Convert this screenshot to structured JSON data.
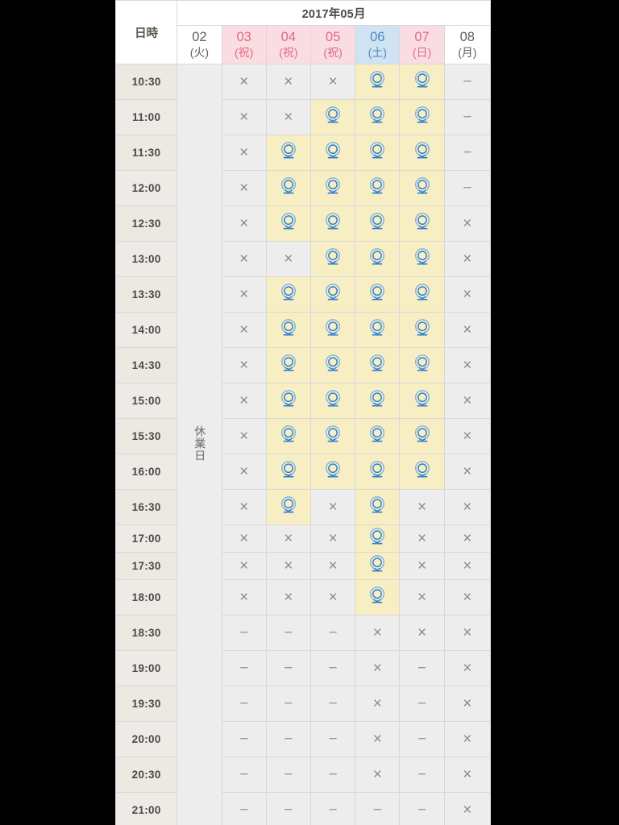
{
  "header": {
    "corner_label": "日時",
    "month_label": "2017年05月",
    "days": [
      {
        "num": "02",
        "weekday": "(火)",
        "kind": "plain"
      },
      {
        "num": "03",
        "weekday": "(祝)",
        "kind": "holiday"
      },
      {
        "num": "04",
        "weekday": "(祝)",
        "kind": "holiday"
      },
      {
        "num": "05",
        "weekday": "(祝)",
        "kind": "holiday"
      },
      {
        "num": "06",
        "weekday": "(土)",
        "kind": "sat"
      },
      {
        "num": "07",
        "weekday": "(日)",
        "kind": "holiday"
      },
      {
        "num": "08",
        "weekday": "(月)",
        "kind": "plain"
      }
    ]
  },
  "closed_column": {
    "label": "休業日",
    "chars": [
      "休",
      "業",
      "日"
    ]
  },
  "legend": {
    "available_symbol": "◎",
    "unavailable_symbol": "×",
    "na_symbol": "−"
  },
  "colors": {
    "holiday_header_bg": "#fadde3",
    "holiday_header_fg": "#e06a80",
    "saturday_header_bg": "#cfe3f2",
    "saturday_header_fg": "#4d86c6",
    "available_cell_bg": "#f7eec4",
    "available_mark_fg": "#4d94d6",
    "cell_bg": "#ededed",
    "time_cell_bg": "#ece8e2",
    "border": "#d8d8d8",
    "page_bg": "#ffffff",
    "frame_bg": "#000000"
  },
  "table": {
    "time_column_header": "日時",
    "day_columns": [
      "02",
      "03",
      "04",
      "05",
      "06",
      "07",
      "08"
    ],
    "rows": [
      {
        "time": "10:30",
        "short": false,
        "cells": [
          "closed",
          "x",
          "x",
          "x",
          "o",
          "o",
          "-"
        ]
      },
      {
        "time": "11:00",
        "short": false,
        "cells": [
          "closed",
          "x",
          "x",
          "o",
          "o",
          "o",
          "-"
        ]
      },
      {
        "time": "11:30",
        "short": false,
        "cells": [
          "closed",
          "x",
          "o",
          "o",
          "o",
          "o",
          "-"
        ]
      },
      {
        "time": "12:00",
        "short": false,
        "cells": [
          "closed",
          "x",
          "o",
          "o",
          "o",
          "o",
          "-"
        ]
      },
      {
        "time": "12:30",
        "short": false,
        "cells": [
          "closed",
          "x",
          "o",
          "o",
          "o",
          "o",
          "x"
        ]
      },
      {
        "time": "13:00",
        "short": false,
        "cells": [
          "closed",
          "x",
          "x",
          "o",
          "o",
          "o",
          "x"
        ]
      },
      {
        "time": "13:30",
        "short": false,
        "cells": [
          "closed",
          "x",
          "o",
          "o",
          "o",
          "o",
          "x"
        ]
      },
      {
        "time": "14:00",
        "short": false,
        "cells": [
          "closed",
          "x",
          "o",
          "o",
          "o",
          "o",
          "x"
        ]
      },
      {
        "time": "14:30",
        "short": false,
        "cells": [
          "closed",
          "x",
          "o",
          "o",
          "o",
          "o",
          "x"
        ]
      },
      {
        "time": "15:00",
        "short": false,
        "cells": [
          "closed",
          "x",
          "o",
          "o",
          "o",
          "o",
          "x"
        ]
      },
      {
        "time": "15:30",
        "short": false,
        "cells": [
          "closed",
          "x",
          "o",
          "o",
          "o",
          "o",
          "x"
        ]
      },
      {
        "time": "16:00",
        "short": false,
        "cells": [
          "closed",
          "x",
          "o",
          "o",
          "o",
          "o",
          "x"
        ]
      },
      {
        "time": "16:30",
        "short": false,
        "cells": [
          "closed",
          "x",
          "o",
          "x",
          "o",
          "x",
          "x"
        ]
      },
      {
        "time": "17:00",
        "short": true,
        "cells": [
          "closed",
          "x",
          "x",
          "x",
          "o",
          "x",
          "x"
        ]
      },
      {
        "time": "17:30",
        "short": true,
        "cells": [
          "closed",
          "x",
          "x",
          "x",
          "o",
          "x",
          "x"
        ]
      },
      {
        "time": "18:00",
        "short": false,
        "cells": [
          "closed",
          "x",
          "x",
          "x",
          "o",
          "x",
          "x"
        ]
      },
      {
        "time": "18:30",
        "short": false,
        "cells": [
          "closed",
          "-",
          "-",
          "-",
          "x",
          "x",
          "x"
        ]
      },
      {
        "time": "19:00",
        "short": false,
        "cells": [
          "closed",
          "-",
          "-",
          "-",
          "x",
          "-",
          "x"
        ]
      },
      {
        "time": "19:30",
        "short": false,
        "cells": [
          "closed",
          "-",
          "-",
          "-",
          "x",
          "-",
          "x"
        ]
      },
      {
        "time": "20:00",
        "short": false,
        "cells": [
          "closed",
          "-",
          "-",
          "-",
          "x",
          "-",
          "x"
        ]
      },
      {
        "time": "20:30",
        "short": false,
        "cells": [
          "closed",
          "-",
          "-",
          "-",
          "x",
          "-",
          "x"
        ]
      },
      {
        "time": "21:00",
        "short": false,
        "cells": [
          "closed",
          "-",
          "-",
          "-",
          "-",
          "-",
          "x"
        ]
      }
    ]
  }
}
